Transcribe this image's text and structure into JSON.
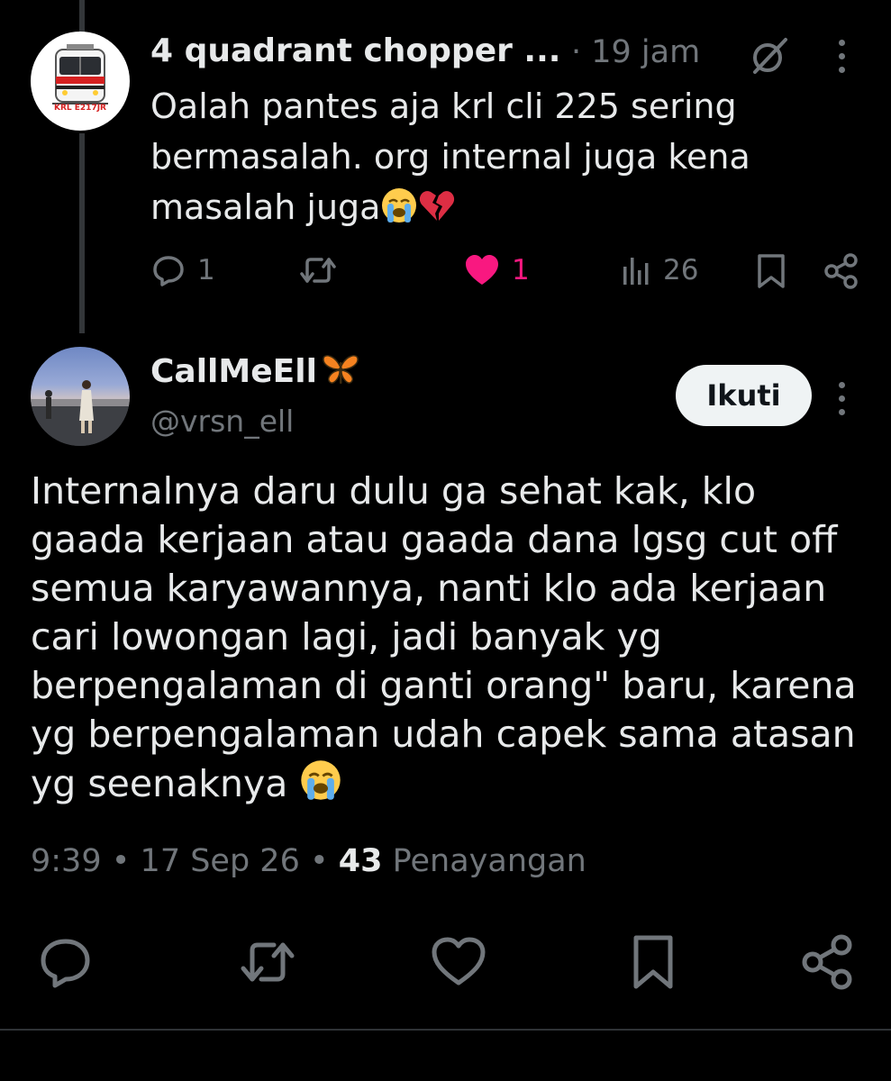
{
  "reply_tweet": {
    "author_name": "4 quadrant chopper ...",
    "time": "· 19 jam",
    "avatar_label": "KRL E217JR",
    "text": "Oalah pantes aja krl cli 225 sering bermasalah. org internal juga kena masalah juga",
    "text_emojis": [
      "loudly-crying-face",
      "broken-heart"
    ],
    "actions": {
      "reply_count": "1",
      "retweet_count": "",
      "like_count": "1",
      "views_count": "26"
    },
    "colors": {
      "like": "#f91880",
      "muted": "#71767b"
    }
  },
  "main_tweet": {
    "author_name": "CallMeEll",
    "author_emoji": "butterfly",
    "handle": "@vrsn_ell",
    "follow_label": "Ikuti",
    "text": "Internalnya daru dulu ga sehat kak, klo gaada kerjaan atau gaada dana lgsg cut off semua karyawannya, nanti klo ada kerjaan cari lowongan lagi, jadi banyak yg berpengalaman di ganti orang\" baru, karena yg berpengalaman udah capek sama atasan yg seenaknya",
    "text_emoji": "loudly-crying-face",
    "meta": {
      "time": "9:39",
      "date": "17 Sep 26",
      "views_count": "43",
      "views_label": "Penayangan",
      "separator": "•"
    }
  },
  "bottom_actions": [
    "reply-icon",
    "retweet-icon",
    "like-icon",
    "bookmark-icon",
    "share-icon"
  ]
}
